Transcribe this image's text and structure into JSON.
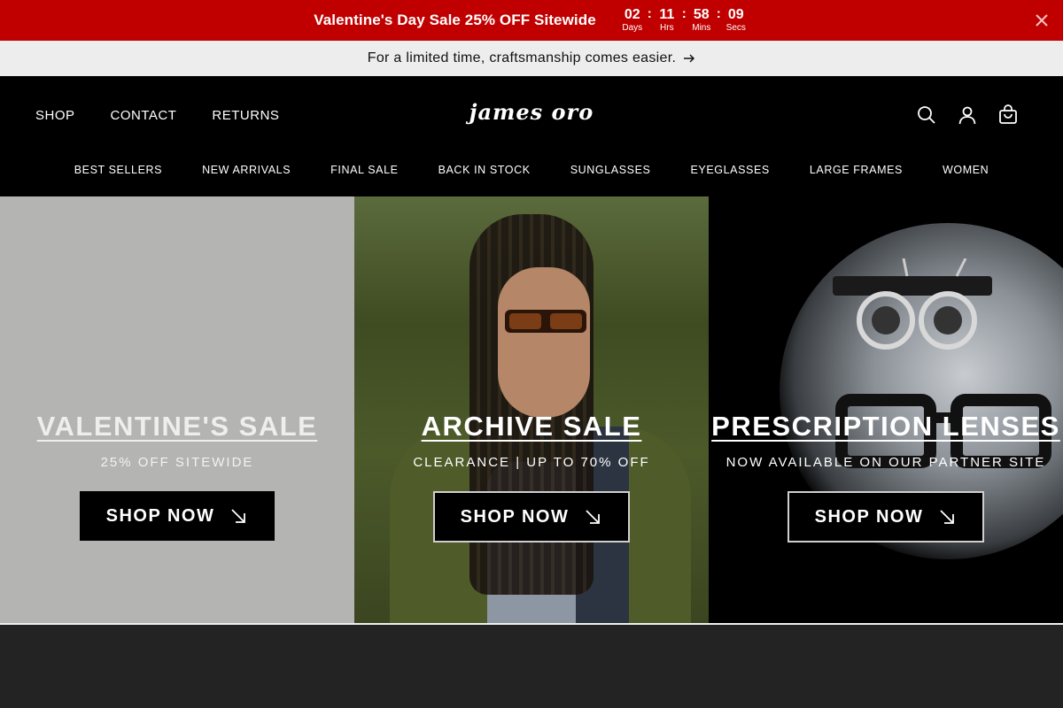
{
  "promo": {
    "text": "Valentine's Day Sale 25% OFF Sitewide",
    "countdown": [
      {
        "value": "02",
        "label": "Days"
      },
      {
        "value": "11",
        "label": "Hrs"
      },
      {
        "value": "58",
        "label": "Mins"
      },
      {
        "value": "09",
        "label": "Secs"
      }
    ],
    "separator": ":",
    "close_icon": "close-icon",
    "bg_color": "#c00000"
  },
  "announcement": {
    "text": "For a limited time, craftsmanship comes easier.",
    "icon": "arrow-right-icon"
  },
  "header": {
    "nav_left": [
      "SHOP",
      "CONTACT",
      "RETURNS"
    ],
    "logo": "james oro",
    "icons": [
      "search-icon",
      "account-icon",
      "cart-icon"
    ],
    "categories": [
      "BEST SELLERS",
      "NEW ARRIVALS",
      "FINAL SALE",
      "BACK IN STOCK",
      "SUNGLASSES",
      "EYEGLASSES",
      "LARGE FRAMES",
      "WOMEN"
    ]
  },
  "hero": {
    "panels": [
      {
        "title": "VALENTINE'S SALE",
        "subtitle": "25% OFF SITEWIDE",
        "button": "SHOP NOW",
        "button_icon": "arrow-down-right-icon"
      },
      {
        "title": "ARCHIVE SALE",
        "subtitle": "CLEARANCE | UP TO 70% OFF",
        "button": "SHOP NOW",
        "button_icon": "arrow-down-right-icon"
      },
      {
        "title": "PRESCRIPTION LENSES",
        "subtitle": "NOW AVAILABLE ON OUR PARTNER SITE",
        "button": "SHOP NOW",
        "button_icon": "arrow-down-right-icon"
      }
    ]
  }
}
